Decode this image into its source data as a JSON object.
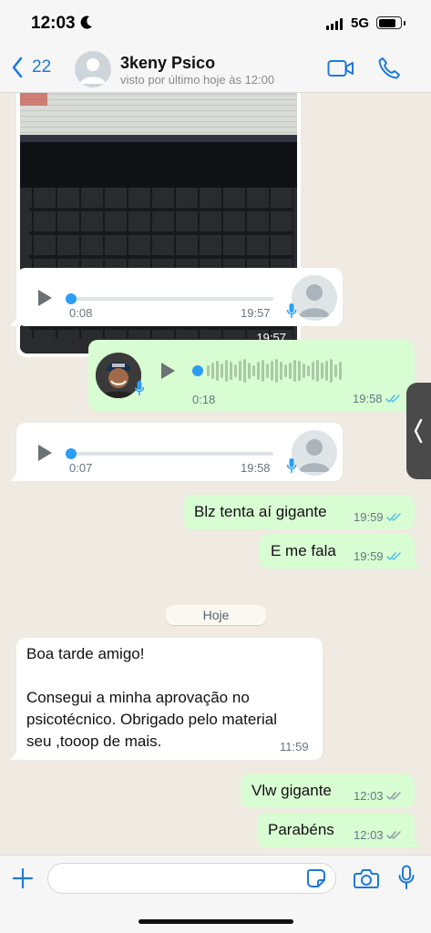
{
  "status_bar": {
    "time": "12:03",
    "network": "5G"
  },
  "header": {
    "back_count": "22",
    "contact_name": "3keny Psico",
    "contact_status": "visto por último hoje às 12:00"
  },
  "messages": {
    "image": {
      "time": "19:57"
    },
    "voice1": {
      "duration": "0:08",
      "time": "19:57"
    },
    "voice2": {
      "duration": "0:18",
      "time": "19:58"
    },
    "voice3": {
      "duration": "0:07",
      "time": "19:58"
    },
    "text1": {
      "text": "Blz tenta aí gigante",
      "time": "19:59"
    },
    "text2": {
      "text": "E me fala",
      "time": "19:59"
    },
    "date_separator": "Hoje",
    "incoming": {
      "line1": "Boa tarde amigo!",
      "line2": "Consegui a minha aprovação no",
      "line3": "psicotécnico. Obrigado pelo material",
      "line4": "seu ,tooop de mais.",
      "time": "11:59"
    },
    "text3": {
      "text": "Vlw gigante",
      "time": "12:03"
    },
    "text4": {
      "text": "Parabéns",
      "time": "12:03"
    }
  },
  "input": {
    "placeholder": "",
    "value": ""
  },
  "colors": {
    "accent": "#1f7ad8",
    "outgoing_bubble": "#d9fdd3",
    "incoming_bubble": "#ffffff",
    "read_ticks": "#53bdeb",
    "background": "#efeae2"
  },
  "icons": [
    "moon-icon",
    "back-chevron-icon",
    "video-call-icon",
    "phone-icon",
    "play-icon",
    "mic-icon",
    "double-check-icon",
    "plus-icon",
    "sticker-icon",
    "camera-icon"
  ]
}
